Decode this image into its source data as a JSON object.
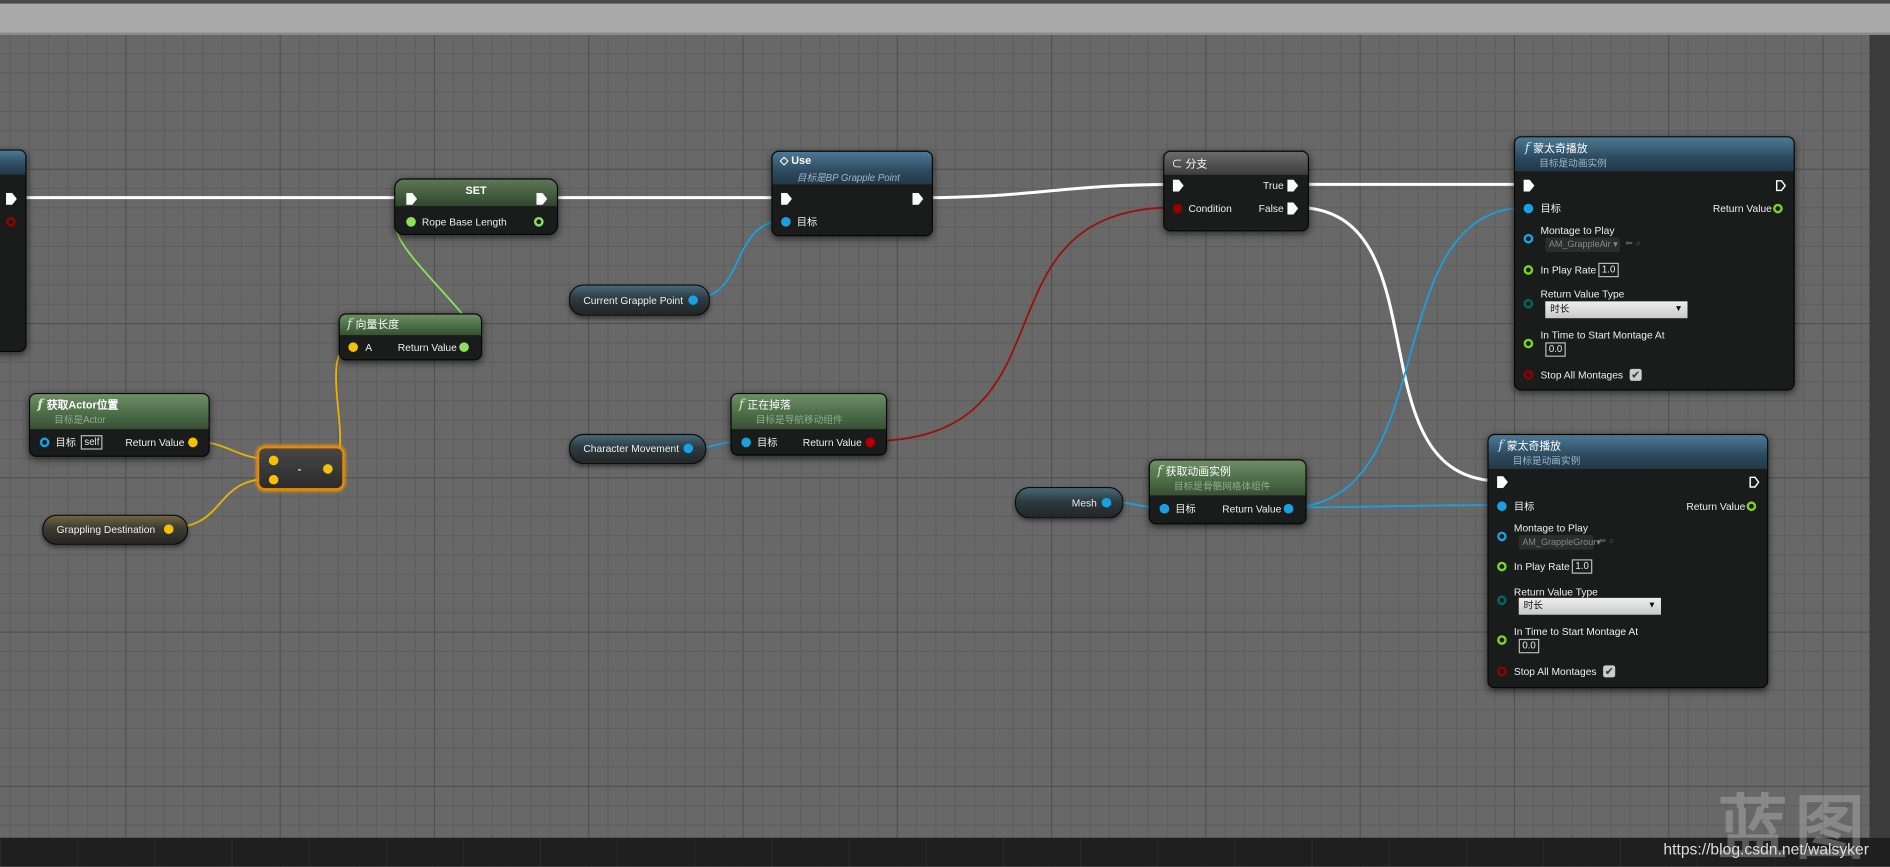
{
  "colors": {
    "exec": "#ffffff",
    "object": "#00a8f0",
    "float": "#7ed321",
    "vector": "#f5c000",
    "bool": "#950000",
    "enum": "#00666a"
  },
  "left_node": {},
  "set_node": {
    "title": "SET",
    "pin": "Rope Base Length"
  },
  "use_node": {
    "title": "Use",
    "subtitle": "目标是BP Grapple Point",
    "target": "目标"
  },
  "branch_node": {
    "title": "分支",
    "true_label": "True",
    "condition": "Condition",
    "false_label": "False"
  },
  "montage_air": {
    "title": "蒙太奇播放",
    "subtitle": "目标是动画实例",
    "target": "目标",
    "return_value": "Return Value",
    "montage_label": "Montage to Play",
    "montage_value": "AM_GrappleAir",
    "play_rate_label": "In Play Rate",
    "play_rate": "1.0",
    "rvt_label": "Return Value Type",
    "rvt_value": "时长",
    "start_label": "In Time to Start Montage At",
    "start_value": "0.0",
    "stop_label": "Stop All Montages",
    "stop_checked": true
  },
  "montage_ground": {
    "title": "蒙太奇播放",
    "subtitle": "目标是动画实例",
    "target": "目标",
    "return_value": "Return Value",
    "montage_label": "Montage to Play",
    "montage_value": "AM_GrappleGrour",
    "play_rate_label": "In Play Rate",
    "play_rate": "1.0",
    "rvt_label": "Return Value Type",
    "rvt_value": "时长",
    "start_label": "In Time to Start Montage At",
    "start_value": "0.0",
    "stop_label": "Stop All Montages",
    "stop_checked": true
  },
  "vector_length": {
    "title": "向量长度",
    "a": "A",
    "return_value": "Return Value"
  },
  "get_actor_location": {
    "title": "获取Actor位置",
    "subtitle": "目标是Actor",
    "target": "目标",
    "self": "self",
    "return_value": "Return Value"
  },
  "subtract": {
    "symbol": "-"
  },
  "vars": {
    "grappling_destination": "Grappling Destination",
    "current_grapple_point": "Current Grapple Point",
    "character_movement": "Character Movement",
    "mesh": "Mesh"
  },
  "is_falling": {
    "title": "正在掉落",
    "subtitle": "目标是导航移动组件",
    "target": "目标",
    "return_value": "Return Value"
  },
  "get_anim_instance": {
    "title": "获取动画实例",
    "subtitle": "目标是骨骼网格体组件",
    "target": "目标",
    "return_value": "Return Value"
  },
  "watermark": {
    "logo": "蓝图",
    "url": "https://blog.csdn.net/walsyker"
  }
}
